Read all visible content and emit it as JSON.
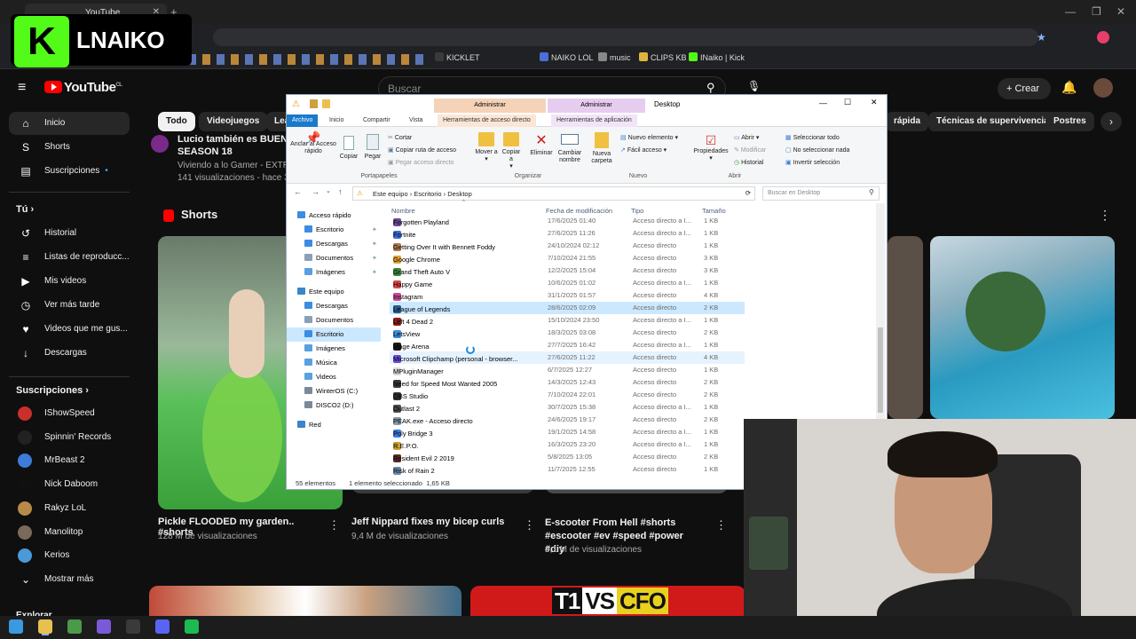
{
  "browser": {
    "tab_title": "YouTube",
    "bookmarks": [
      {
        "label": "KICKLET",
        "color": "#3a3a3a"
      },
      {
        "label": "NAIKO LOL",
        "color": "#4a6fd8"
      },
      {
        "label": "music",
        "color": "#888888"
      },
      {
        "label": "CLIPS KB",
        "color": "#e0b33c"
      },
      {
        "label": "INaiko | Kick",
        "color": "#53fc18"
      }
    ]
  },
  "overlay": {
    "k": "K",
    "name": "LNAIKO"
  },
  "youtube": {
    "logo": "YouTube",
    "logo_sup": "CL",
    "search_placeholder": "Buscar",
    "create_label": "Crear",
    "nav": [
      {
        "label": "Inicio",
        "icon": "home-icon",
        "glyph": "⌂"
      },
      {
        "label": "Shorts",
        "icon": "shorts-icon",
        "glyph": "S"
      },
      {
        "label": "Suscripciones",
        "icon": "subscriptions-icon",
        "glyph": "▤"
      }
    ],
    "you_header": "Tú",
    "you_items": [
      {
        "label": "Historial",
        "glyph": "↺"
      },
      {
        "label": "Listas de reproducc...",
        "glyph": "≡"
      },
      {
        "label": "Mis videos",
        "glyph": "▶"
      },
      {
        "label": "Ver más tarde",
        "glyph": "◷"
      },
      {
        "label": "Videos que me gus...",
        "glyph": "♥"
      },
      {
        "label": "Descargas",
        "glyph": "↓"
      }
    ],
    "subs_header": "Suscripciones",
    "subs": [
      {
        "label": "IShowSpeed",
        "color": "#c9302c"
      },
      {
        "label": "Spinnin' Records",
        "color": "#222222"
      },
      {
        "label": "MrBeast 2",
        "color": "#3d7bd8"
      },
      {
        "label": "Nick Daboom",
        "color": "#101010"
      },
      {
        "label": "Rakyz LoL",
        "color": "#b88a4a"
      },
      {
        "label": "Manolitop",
        "color": "#7a6a5a"
      },
      {
        "label": "Kerios",
        "color": "#4a9ad8"
      }
    ],
    "show_more": "Mostrar más",
    "explore": "Explorar",
    "chips": [
      "Todo",
      "Videojuegos",
      "Lea",
      "rápida",
      "Técnicas de supervivencia",
      "Postres"
    ],
    "top_video": {
      "title_line1": "Lucio también es BUENO",
      "title_line2": "SEASON 18",
      "channel": "Viviendo a lo Gamer - EXTRA",
      "meta": "141 visualizaciones - hace 3"
    },
    "shorts_header": "Shorts",
    "shorts": [
      {
        "title": "Pickle FLOODED my garden.. #shorts",
        "meta": "128 M de visualizaciones"
      },
      {
        "title": "Jeff Nippard fixes my bicep curls",
        "meta": "9,4 M de visualizaciones"
      },
      {
        "title": "E-scooter From Hell #shorts #escooter #ev #speed #power #diy",
        "meta": "6,1 M de visualizaciones"
      }
    ],
    "banner_text_a": "T1",
    "banner_text_vs": "VS",
    "banner_text_b": "CFO"
  },
  "explorer": {
    "window_title": "Desktop",
    "context_admin1": "Administrar",
    "context_admin2": "Administrar",
    "tabs": [
      "Archivo",
      "Inicio",
      "Compartir",
      "Vista",
      "Herramientas de acceso directo",
      "Herramientas de aplicación"
    ],
    "ribbon": {
      "pin": "Anclar al Acceso rápido",
      "copy": "Copiar",
      "paste": "Pegar",
      "cut": "Cortar",
      "copy_path": "Copiar ruta de acceso",
      "paste_shortcut": "Pegar acceso directo",
      "move_to": "Mover a",
      "copy_to": "Copiar a",
      "delete": "Eliminar",
      "rename": "Cambiar nombre",
      "new_folder": "Nueva carpeta",
      "new_item": "Nuevo elemento",
      "easy_access": "Fácil acceso",
      "properties": "Propiedades",
      "open": "Abrir",
      "modify": "Modificar",
      "history": "Historial",
      "select_all": "Seleccionar todo",
      "select_none": "No seleccionar nada",
      "invert": "Invertir selección",
      "group_clipboard": "Portapapeles",
      "group_organize": "Organizar",
      "group_new": "Nuevo",
      "group_open": "Abrir",
      "group_select": "Seleccionar"
    },
    "path": [
      "Este equipo",
      "Escritorio",
      "Desktop"
    ],
    "search_placeholder": "Buscar en Desktop",
    "tree": [
      {
        "label": "Acceso rápido",
        "color": "#3b8de0",
        "indent": 0,
        "pin": false
      },
      {
        "label": "Escritorio",
        "color": "#3b8de0",
        "indent": 1,
        "pin": true
      },
      {
        "label": "Descargas",
        "color": "#3b8de0",
        "indent": 1,
        "pin": true
      },
      {
        "label": "Documentos",
        "color": "#8aa0b8",
        "indent": 1,
        "pin": true
      },
      {
        "label": "Imágenes",
        "color": "#5aa0e0",
        "indent": 1,
        "pin": true
      },
      {
        "label": "Este equipo",
        "color": "#3a86c8",
        "indent": 0,
        "pin": false
      },
      {
        "label": "Descargas",
        "color": "#3b8de0",
        "indent": 1,
        "pin": false
      },
      {
        "label": "Documentos",
        "color": "#8aa0b8",
        "indent": 1,
        "pin": false
      },
      {
        "label": "Escritorio",
        "color": "#3b8de0",
        "indent": 1,
        "pin": false,
        "selected": true
      },
      {
        "label": "Imágenes",
        "color": "#5aa0e0",
        "indent": 1,
        "pin": false
      },
      {
        "label": "Música",
        "color": "#5aa0e0",
        "indent": 1,
        "pin": false
      },
      {
        "label": "Videos",
        "color": "#5aa0e0",
        "indent": 1,
        "pin": false
      },
      {
        "label": "WinterOS (C:)",
        "color": "#7a8a9a",
        "indent": 1,
        "pin": false
      },
      {
        "label": "DISCO2 (D:)",
        "color": "#7a8a9a",
        "indent": 1,
        "pin": false
      },
      {
        "label": "Red",
        "color": "#3a86c8",
        "indent": 0,
        "pin": false
      }
    ],
    "columns": [
      "Nombre",
      "Fecha de modificación",
      "Tipo",
      "Tamaño"
    ],
    "files": [
      {
        "name": "Forgotten Playland",
        "date": "17/6/2025 01:40",
        "type": "Acceso directo a I...",
        "size": "1 KB",
        "color": "#6a4a9a"
      },
      {
        "name": "Fortnite",
        "date": "27/6/2025 11:26",
        "type": "Acceso directo a I...",
        "size": "1 KB",
        "color": "#3a6ad8"
      },
      {
        "name": "Getting Over It with Bennett Foddy",
        "date": "24/10/2024 02:12",
        "type": "Acceso directo",
        "size": "1 KB",
        "color": "#b07a4a"
      },
      {
        "name": "Google Chrome",
        "date": "7/10/2024 21:55",
        "type": "Acceso directo",
        "size": "3 KB",
        "color": "#e0a030"
      },
      {
        "name": "Grand Theft Auto V",
        "date": "12/2/2025 15:04",
        "type": "Acceso directo",
        "size": "3 KB",
        "color": "#3a8a3a"
      },
      {
        "name": "Happy Game",
        "date": "10/6/2025 01:02",
        "type": "Acceso directo a I...",
        "size": "1 KB",
        "color": "#d84a4a"
      },
      {
        "name": "Instagram",
        "date": "31/1/2025 01:57",
        "type": "Acceso directo",
        "size": "4 KB",
        "color": "#c84a9a"
      },
      {
        "name": "League of Legends",
        "date": "28/6/2025 02:09",
        "type": "Acceso directo",
        "size": "2 KB",
        "color": "#2a5a8a",
        "selected": true
      },
      {
        "name": "Left 4 Dead 2",
        "date": "15/10/2024 23:50",
        "type": "Acceso directo a I...",
        "size": "1 KB",
        "color": "#8a1a1a"
      },
      {
        "name": "LetsView",
        "date": "18/3/2025 03:08",
        "type": "Acceso directo",
        "size": "2 KB",
        "color": "#3a8ae0"
      },
      {
        "name": "Mage Arena",
        "date": "27/7/2025 16:42",
        "type": "Acceso directo a I...",
        "size": "1 KB",
        "color": "#1a1a1a"
      },
      {
        "name": "Microsoft Clipchamp (personal - browser...",
        "date": "27/6/2025 11:22",
        "type": "Acceso directo",
        "size": "4 KB",
        "color": "#6a4ad8",
        "hover": true
      },
      {
        "name": "MPluginManager",
        "date": "6/7/2025 12:27",
        "type": "Acceso directo",
        "size": "1 KB",
        "color": "#d8d8d8"
      },
      {
        "name": "Need for Speed Most Wanted 2005",
        "date": "14/3/2025 12:43",
        "type": "Acceso directo",
        "size": "2 KB",
        "color": "#3a3a3a"
      },
      {
        "name": "OBS Studio",
        "date": "7/10/2024 22:01",
        "type": "Acceso directo",
        "size": "2 KB",
        "color": "#303030"
      },
      {
        "name": "Outlast 2",
        "date": "30/7/2025 15:38",
        "type": "Acceso directo a I...",
        "size": "1 KB",
        "color": "#4a4a4a"
      },
      {
        "name": "PEAK.exe - Acceso directo",
        "date": "24/6/2025 19:17",
        "type": "Acceso directo",
        "size": "2 KB",
        "color": "#8a9aaa"
      },
      {
        "name": "Poly Bridge 3",
        "date": "19/1/2025 14:58",
        "type": "Acceso directo a I...",
        "size": "1 KB",
        "color": "#3a7ad8"
      },
      {
        "name": "R.E.P.O.",
        "date": "16/3/2025 23:20",
        "type": "Acceso directo a I...",
        "size": "1 KB",
        "color": "#c8a030"
      },
      {
        "name": "Resident Evil 2 2019",
        "date": "5/8/2025 13:05",
        "type": "Acceso directo",
        "size": "2 KB",
        "color": "#5a2a2a"
      },
      {
        "name": "Risk of Rain 2",
        "date": "11/7/2025 12:55",
        "type": "Acceso directo",
        "size": "1 KB",
        "color": "#6a8aaa"
      }
    ],
    "status_count": "55 elementos",
    "status_selected": "1 elemento seleccionado  1,65 KB"
  },
  "taskbar": [
    {
      "icon": "windows-icon",
      "color": "#3a9ae0"
    },
    {
      "icon": "explorer-icon",
      "color": "#e8c050"
    },
    {
      "icon": "chrome-icon",
      "color": "#4a9a4a"
    },
    {
      "icon": "app-icon",
      "color": "#7a5ad8"
    },
    {
      "icon": "obs-icon",
      "color": "#3a3a3a"
    },
    {
      "icon": "discord-icon",
      "color": "#5865f2"
    },
    {
      "icon": "spotify-icon",
      "color": "#1db954"
    }
  ]
}
